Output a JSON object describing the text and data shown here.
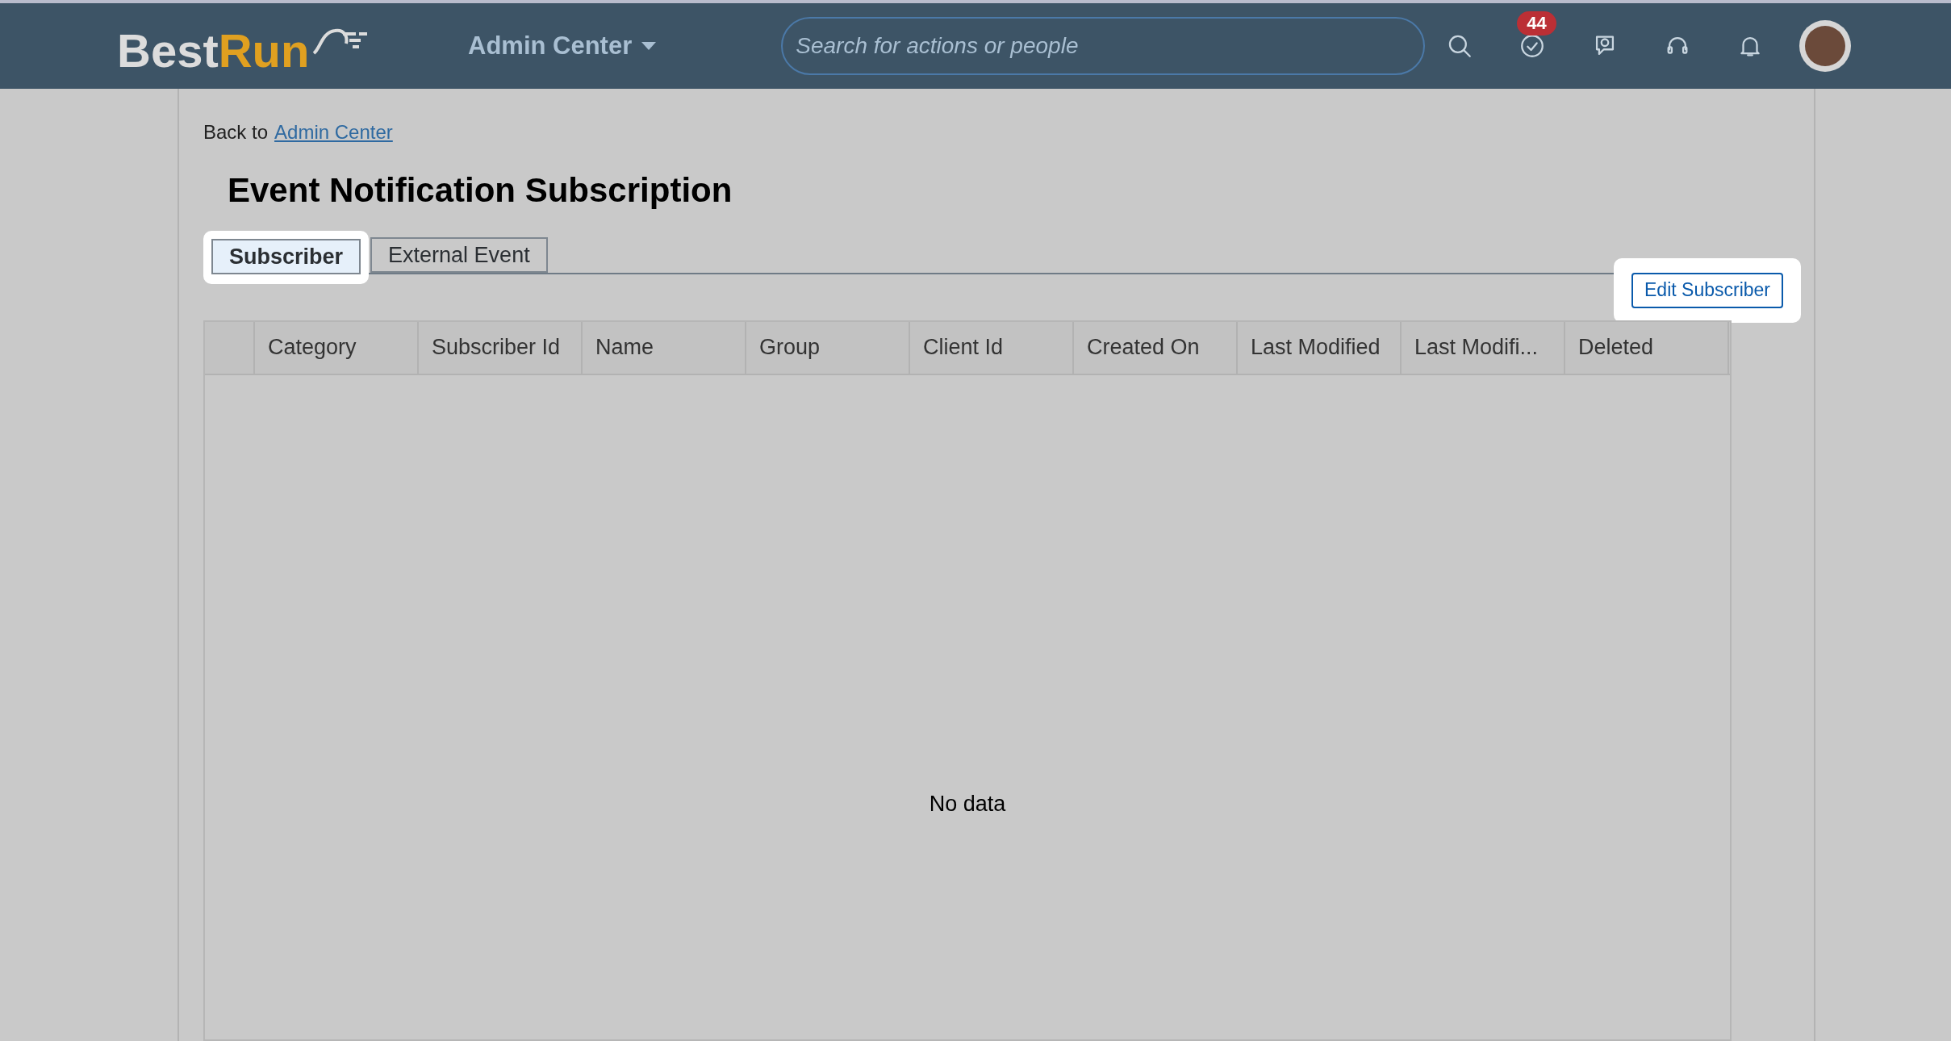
{
  "header": {
    "logo": {
      "part_1": "Best",
      "part_2": "Run"
    },
    "app_menu": "Admin Center",
    "search": {
      "placeholder": "Search for actions or people"
    },
    "todo_badge": "44"
  },
  "breadcrumb": {
    "prefix": "Back to",
    "link": "Admin Center"
  },
  "title": "Event Notification Subscription",
  "tabs": [
    {
      "label": "Subscriber",
      "selected": true,
      "highlighted": true
    },
    {
      "label": "External Event",
      "selected": false,
      "highlighted": false
    }
  ],
  "edit_button": {
    "label": "Edit Subscriber",
    "highlighted": true
  },
  "table": {
    "columns": [
      "Category",
      "Subscriber Id",
      "Name",
      "Group",
      "Client Id",
      "Created On",
      "Last Modified",
      "Last Modifi...",
      "Deleted"
    ],
    "empty_text": "No data"
  }
}
